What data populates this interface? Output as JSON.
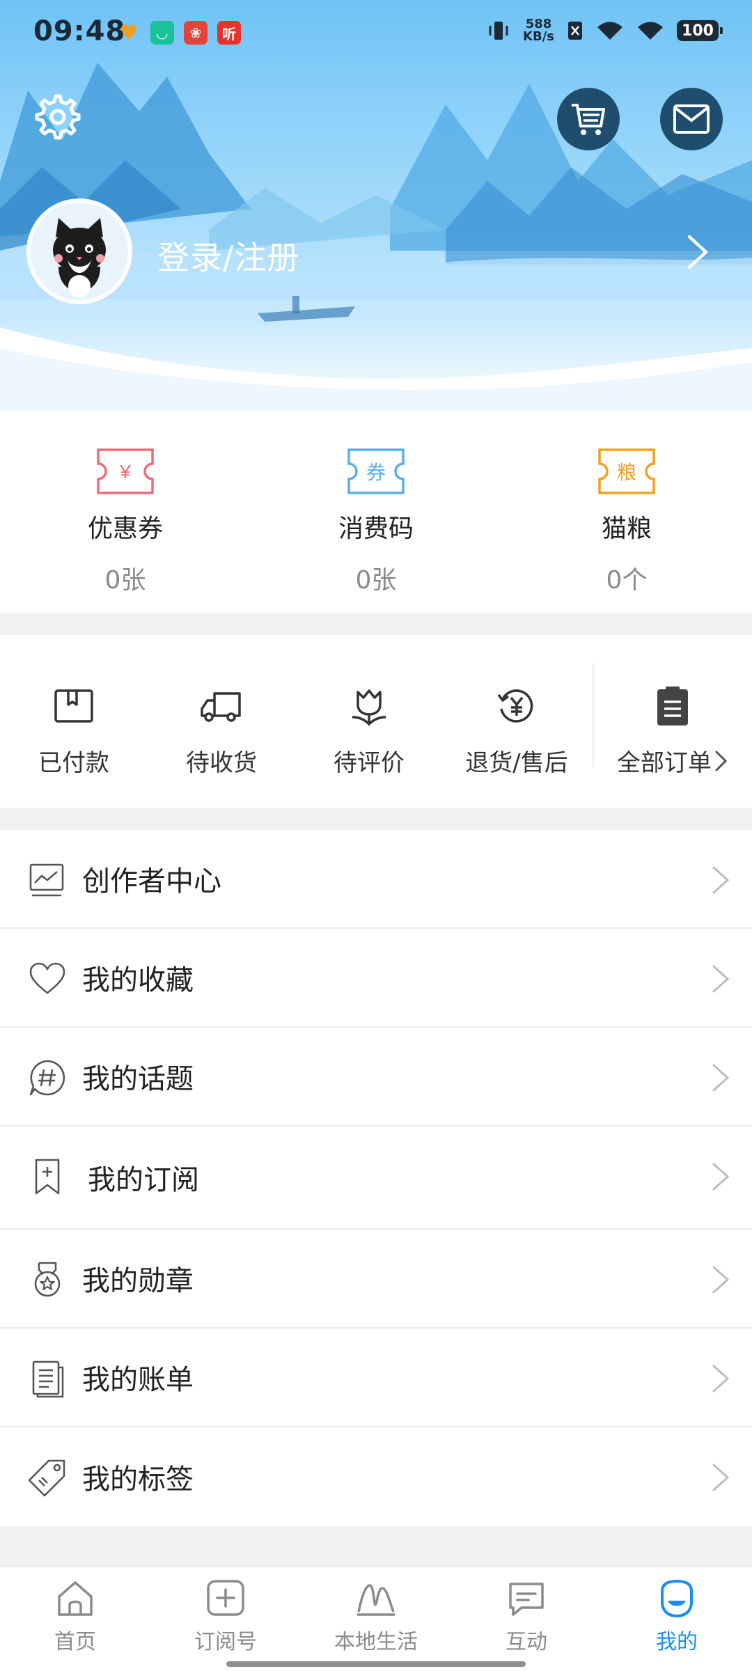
{
  "status_bar": {
    "time": "09:48",
    "net_speed_value": "588",
    "net_speed_unit": "KB/s",
    "battery": "100",
    "notification_app_icons": [
      "heart-app-icon",
      "mi-app-icon",
      "red-envelope-app-icon",
      "ting-app-icon"
    ],
    "ting_label": "听"
  },
  "header": {
    "login_text": "登录/注册",
    "accent_color": "#6fc3f5",
    "icons": [
      "settings-gear-icon",
      "shopping-cart-icon",
      "mail-icon",
      "cat-avatar",
      "chevron-right-icon"
    ]
  },
  "assets": [
    {
      "name": "coupon",
      "label": "优惠券",
      "count": "0张",
      "icon": "coupon-ticket-icon",
      "icon_text": "¥",
      "color": "#f06a7a"
    },
    {
      "name": "consumption-code",
      "label": "消费码",
      "count": "0张",
      "icon": "voucher-ticket-icon",
      "icon_text": "券",
      "color": "#5aaeea"
    },
    {
      "name": "cat-food",
      "label": "猫粮",
      "count": "0个",
      "icon": "grain-ticket-icon",
      "icon_text": "粮",
      "color": "#f2a11f"
    }
  ],
  "orders": {
    "items": [
      {
        "name": "paid",
        "label": "已付款",
        "icon": "paid-box-icon"
      },
      {
        "name": "to-receive",
        "label": "待收货",
        "icon": "delivery-truck-icon"
      },
      {
        "name": "to-review",
        "label": "待评价",
        "icon": "flower-review-icon"
      },
      {
        "name": "refund",
        "label": "退货/售后",
        "icon": "refund-yen-icon"
      }
    ],
    "all_label": "全部订单",
    "all_icon": "clipboard-icon"
  },
  "menu": [
    {
      "name": "creator-center",
      "label": "创作者中心",
      "icon": "chart-board-icon"
    },
    {
      "name": "favorites",
      "label": "我的收藏",
      "icon": "heart-icon"
    },
    {
      "name": "topics",
      "label": "我的话题",
      "icon": "hashtag-bubble-icon"
    },
    {
      "name": "subscriptions",
      "label": "我的订阅",
      "icon": "bookmark-plus-icon"
    },
    {
      "name": "medals",
      "label": "我的勋章",
      "icon": "medal-icon"
    },
    {
      "name": "bills",
      "label": "我的账单",
      "icon": "document-icon"
    },
    {
      "name": "tags",
      "label": "我的标签",
      "icon": "tag-icon"
    }
  ],
  "tabs": [
    {
      "name": "home",
      "label": "首页",
      "icon": "home-icon",
      "active": false
    },
    {
      "name": "subscribe",
      "label": "订阅号",
      "icon": "plus-square-icon",
      "active": false
    },
    {
      "name": "local-life",
      "label": "本地生活",
      "icon": "local-life-icon",
      "active": false
    },
    {
      "name": "interact",
      "label": "互动",
      "icon": "chat-bubble-icon",
      "active": false
    },
    {
      "name": "mine",
      "label": "我的",
      "icon": "mine-smile-icon",
      "active": true
    }
  ],
  "colors": {
    "active_tab": "#1a8ef0",
    "inactive_tab": "#8a8a8a",
    "divider": "#f2f2f2"
  }
}
